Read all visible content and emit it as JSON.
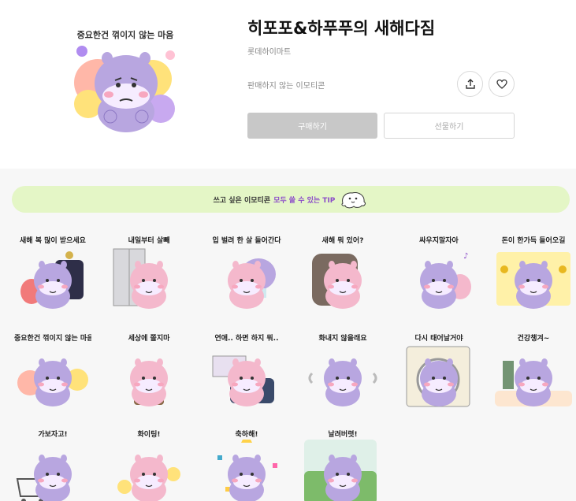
{
  "header": {
    "title": "히포포&하푸푸의 새해다짐",
    "author": "롯데하이마트",
    "not_for_sale": "판매하지 않는 이모티콘",
    "buy_label": "구매하기",
    "gift_label": "선물하기",
    "hero_caption": "중요한건 꺾이지 않는 마음"
  },
  "tip": {
    "text": "쓰고 싶은 이모티콘",
    "highlight": "모두 쓸 수 있는 TIP"
  },
  "stickers": [
    {
      "caption": "새해 복 많이 받으세요",
      "variant": "pair",
      "bg": "#ffffff"
    },
    {
      "caption": "내일부터 살빼",
      "variant": "fridge",
      "bg": "#ffffff"
    },
    {
      "caption": "입 벌려 한 살 들어간다",
      "variant": "eat",
      "bg": "#ffffff"
    },
    {
      "caption": "새해 뭐 있어?",
      "variant": "chair",
      "bg": "#ffffff"
    },
    {
      "caption": "싸우지말자아",
      "variant": "pair2",
      "bg": "#ffffff"
    },
    {
      "caption": "돈이 한가득 들어오길",
      "variant": "money",
      "bg": "#ffffff"
    },
    {
      "caption": "중요한건 꺾이지 않는 마음",
      "variant": "hero",
      "bg": "#ffffff"
    },
    {
      "caption": "세상에 쫄지마",
      "variant": "coat",
      "bg": "#ffffff"
    },
    {
      "caption": "연애.. 하면 하지 뭐..",
      "variant": "sofa",
      "bg": "#ffffff"
    },
    {
      "caption": "화내지 않을래요",
      "variant": "angry",
      "bg": "#ffffff"
    },
    {
      "caption": "다시 태어날거야",
      "variant": "washer",
      "bg": "#ffffff"
    },
    {
      "caption": "건강챙겨~",
      "variant": "blender",
      "bg": "#ffffff"
    },
    {
      "caption": "가보자고!",
      "variant": "cart",
      "bg": "#ffffff"
    },
    {
      "caption": "화이팅!",
      "variant": "cheer",
      "bg": "#ffffff"
    },
    {
      "caption": "축하해!",
      "variant": "party",
      "bg": "#ffffff"
    },
    {
      "caption": "날려버렷!",
      "variant": "golf",
      "bg": "#ffffff"
    }
  ],
  "colors": {
    "purple_hippo": "#b8a6e0",
    "pink_hippo": "#f4b8cc",
    "tip_bg": "#e4f6c6",
    "tip_highlight": "#8b4cc8",
    "buy_bg": "#c8c8c8"
  },
  "icons": {
    "share": "share-icon",
    "like": "heart-icon"
  }
}
